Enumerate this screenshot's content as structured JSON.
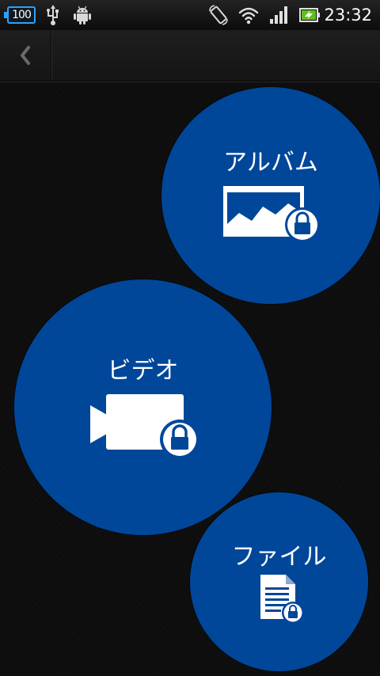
{
  "status_bar": {
    "battery_percent": "100",
    "time": "23:32",
    "icons": [
      "usb-icon",
      "android-debug-icon",
      "auto-rotate-icon",
      "wifi-icon",
      "signal-icon",
      "battery-charging-icon"
    ],
    "accent_color": "#29a3ff"
  },
  "action_bar": {
    "back_icon": "chevron-left-icon"
  },
  "menu": {
    "circle_color": "#00479a",
    "items": [
      {
        "label": "アルバム",
        "icon": "album-lock-icon"
      },
      {
        "label": "ビデオ",
        "icon": "video-lock-icon"
      },
      {
        "label": "ファイル",
        "icon": "file-lock-icon"
      }
    ]
  }
}
